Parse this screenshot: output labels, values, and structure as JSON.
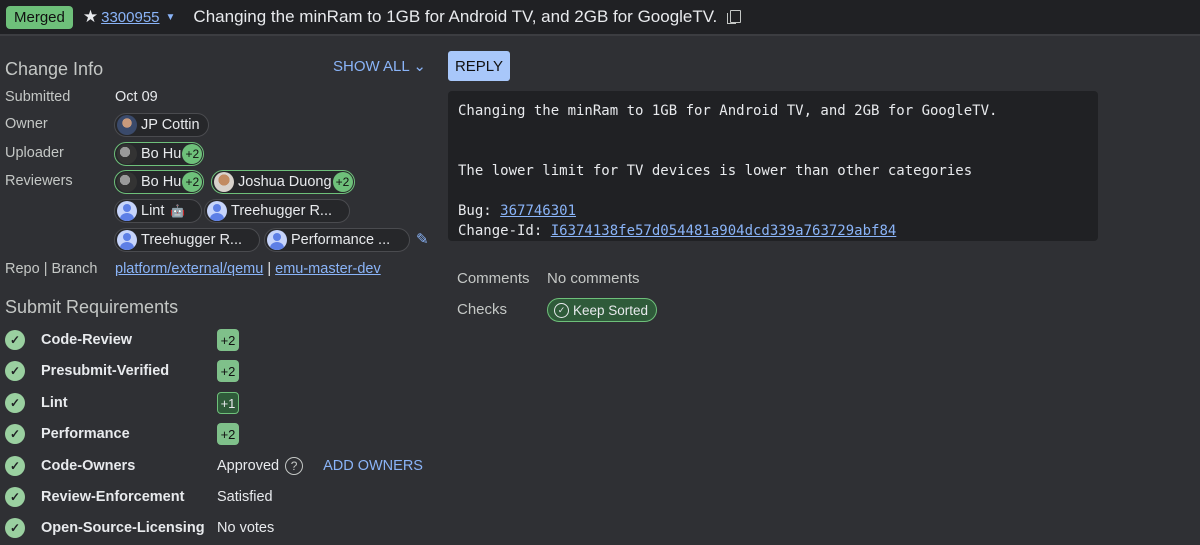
{
  "header": {
    "status": "Merged",
    "change_number": "3300955",
    "subject": "Changing the minRam to 1GB for Android TV, and 2GB for GoogleTV."
  },
  "change_info": {
    "title": "Change Info",
    "show_all": "SHOW ALL",
    "submitted_label": "Submitted",
    "submitted_value": "Oct 09",
    "owner_label": "Owner",
    "owner": "JP Cottin",
    "uploader_label": "Uploader",
    "uploader": {
      "name": "Bo Hu",
      "vote": "+2"
    },
    "reviewers_label": "Reviewers",
    "reviewers": [
      {
        "name": "Bo Hu",
        "vote": "+2"
      },
      {
        "name": "Joshua Duong",
        "vote": "+2"
      },
      {
        "name": "Lint"
      },
      {
        "name": "Treehugger R..."
      },
      {
        "name": "Treehugger R..."
      },
      {
        "name": "Performance ..."
      }
    ],
    "repo_label": "Repo | Branch",
    "repo": "platform/external/qemu",
    "separator": "|",
    "branch": "emu-master-dev"
  },
  "submit_requirements": {
    "title": "Submit Requirements",
    "items": [
      {
        "name": "Code-Review",
        "score": "+2"
      },
      {
        "name": "Presubmit-Verified",
        "score": "+2"
      },
      {
        "name": "Lint",
        "score": "+1"
      },
      {
        "name": "Performance",
        "score": "+2"
      },
      {
        "name": "Code-Owners",
        "value": "Approved",
        "action": "ADD OWNERS"
      },
      {
        "name": "Review-Enforcement",
        "value": "Satisfied"
      },
      {
        "name": "Open-Source-Licensing",
        "value": "No votes"
      }
    ]
  },
  "reply_label": "REPLY",
  "commit_message": {
    "line1": "Changing the minRam to 1GB for Android TV, and 2GB for GoogleTV.",
    "line2": "The lower limit for TV devices is lower than other categories",
    "bug_label": "Bug: ",
    "bug": "367746301",
    "change_id_label": "Change-Id: ",
    "change_id": "I6374138fe57d054481a904dcd339a763729abf84"
  },
  "comments_label": "Comments",
  "comments_value": "No comments",
  "checks_label": "Checks",
  "checks_value": "Keep Sorted",
  "colors": {
    "accent": "#8ab4f8",
    "merged": "#6ec07a",
    "background": "#2f3034"
  }
}
